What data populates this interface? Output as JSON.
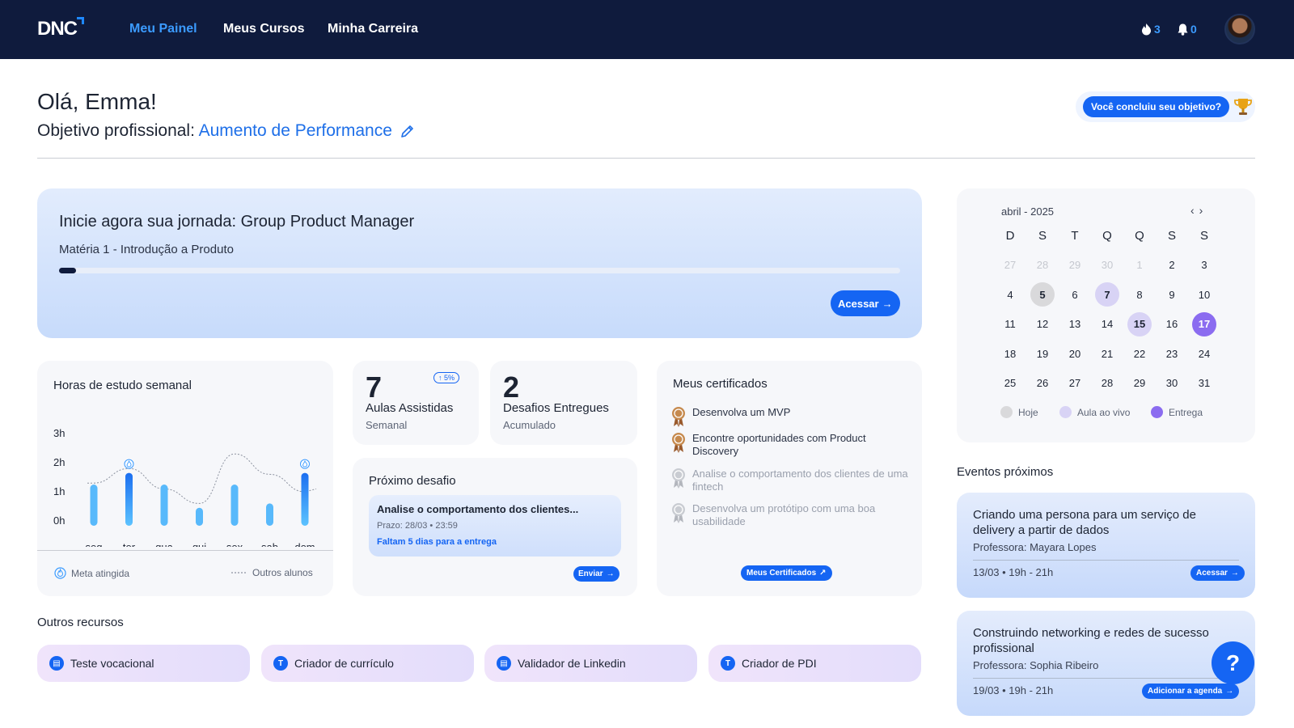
{
  "header": {
    "logo": "DNC",
    "nav": [
      "Meu Painel",
      "Meus Cursos",
      "Minha Carreira"
    ],
    "streak_count": "3",
    "notifications_count": "0"
  },
  "greeting": {
    "hello": "Olá, Emma!",
    "goal_label": "Objetivo profissional:",
    "goal_value": "Aumento de Performance",
    "achievement_button": "Você concluiu seu objetivo?"
  },
  "journey": {
    "title": "Inicie agora sua jornada: Group Product Manager",
    "subject": "Matéria 1 - Introdução a Produto",
    "progress_fraction": 0.02,
    "button": "Acessar"
  },
  "study_hours": {
    "title": "Horas de estudo semanal",
    "legend_goal": "Meta atingida",
    "legend_others": "Outros alunos"
  },
  "chart_data": {
    "type": "bar",
    "title": "Horas de estudo semanal",
    "categories": [
      "seg",
      "ter",
      "qua",
      "qui",
      "sex",
      "sab",
      "dom"
    ],
    "y_ticks": [
      "3h",
      "2h",
      "1h",
      "0h"
    ],
    "ylim": [
      0,
      3
    ],
    "series": [
      {
        "name": "",
        "values": [
          1.25,
          1.65,
          1.25,
          0.45,
          1.25,
          0.6,
          1.65
        ],
        "goal_reached": [
          false,
          true,
          false,
          false,
          false,
          false,
          true
        ]
      },
      {
        "name": "Outros alunos",
        "values": [
          1.3,
          1.8,
          1.1,
          0.6,
          2.3,
          1.6,
          1.0
        ]
      }
    ],
    "legend": [
      "Meta atingida",
      "Outros alunos"
    ]
  },
  "stats": [
    {
      "value": "7",
      "label": "Aulas Assistidas",
      "sub": "Semanal",
      "badge": "5%"
    },
    {
      "value": "2",
      "label": "Desafios Entregues",
      "sub": "Acumulado"
    }
  ],
  "challenge": {
    "title": "Próximo desafio",
    "name": "Analise o comportamento dos clientes...",
    "deadline": "Prazo: 28/03 • 23:59",
    "warning": "Faltam 5 dias para a entrega",
    "button": "Enviar"
  },
  "certificates": {
    "title": "Meus certificados",
    "items": [
      {
        "name": "Desenvolva um MVP",
        "done": true
      },
      {
        "name": "Encontre oportunidades com Product Discovery",
        "done": true
      },
      {
        "name": "Analise o comportamento dos clientes de uma fintech",
        "done": false
      },
      {
        "name": "Desenvolva um protótipo com uma boa usabilidade",
        "done": false
      }
    ],
    "button": "Meus Certificados"
  },
  "calendar": {
    "month": "abril - 2025",
    "weekdays": [
      "D",
      "S",
      "T",
      "Q",
      "Q",
      "S",
      "S"
    ],
    "days": [
      "27",
      "28",
      "29",
      "30",
      "1",
      "2",
      "3",
      "4",
      "5",
      "6",
      "7",
      "8",
      "9",
      "10",
      "11",
      "12",
      "13",
      "14",
      "15",
      "16",
      "17",
      "18",
      "19",
      "20",
      "21",
      "22",
      "23",
      "24",
      "25",
      "26",
      "27",
      "28",
      "29",
      "30",
      "31"
    ],
    "legend": [
      "Hoje",
      "Aula ao vivo",
      "Entrega"
    ],
    "colors": {
      "today": "#d9d9db",
      "live": "#d8d3f5",
      "delivery": "#8b6cf0"
    }
  },
  "events": {
    "title": "Eventos próximos",
    "items": [
      {
        "name": "Criando uma persona para um serviço de delivery a partir de dados",
        "teacher": "Professora: Mayara Lopes",
        "date": "13/03 • 19h - 21h",
        "button": "Acessar"
      },
      {
        "name": "Construindo networking e redes de sucesso profissional",
        "teacher": "Professora: Sophia Ribeiro",
        "date": "19/03 • 19h - 21h",
        "button": "Adicionar a agenda"
      }
    ]
  },
  "resources": {
    "title": "Outros recursos",
    "items": [
      {
        "label": "Teste vocacional",
        "icon": "test-icon"
      },
      {
        "label": "Criador de currículo",
        "icon": "resume-icon"
      },
      {
        "label": "Validador de Linkedin",
        "icon": "linkedin-check-icon"
      },
      {
        "label": "Criador de PDI",
        "icon": "pdi-icon"
      }
    ]
  },
  "help": {
    "label": "?"
  },
  "theme": {
    "accent": "#1565f3",
    "nav_bg": "#0f1b3d",
    "link": "#1e6fe8"
  }
}
